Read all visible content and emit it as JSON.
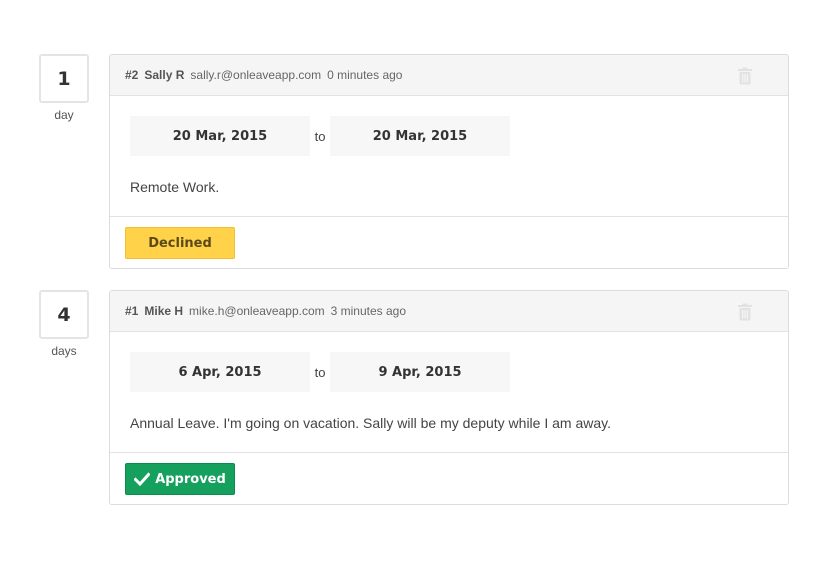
{
  "requests": [
    {
      "days_count": "1",
      "days_label": "day",
      "id": "#2",
      "name": "Sally R",
      "email": "sally.r@onleaveapp.com",
      "time": "0 minutes ago",
      "from_date": "20 Mar, 2015",
      "to_label": "to",
      "to_date": "20 Mar, 2015",
      "note": "Remote Work.",
      "status": "Declined",
      "status_color": "#ffd24a"
    },
    {
      "days_count": "4",
      "days_label": "days",
      "id": "#1",
      "name": "Mike H",
      "email": "mike.h@onleaveapp.com",
      "time": "3 minutes ago",
      "from_date": "6 Apr, 2015",
      "to_label": "to",
      "to_date": "9 Apr, 2015",
      "note": "Annual Leave. I'm going on vacation. Sally will be my deputy while I am away.",
      "status": "Approved",
      "status_color": "#16a05d"
    }
  ],
  "icons": {
    "delete": "trash-icon",
    "approved": "check-icon"
  }
}
